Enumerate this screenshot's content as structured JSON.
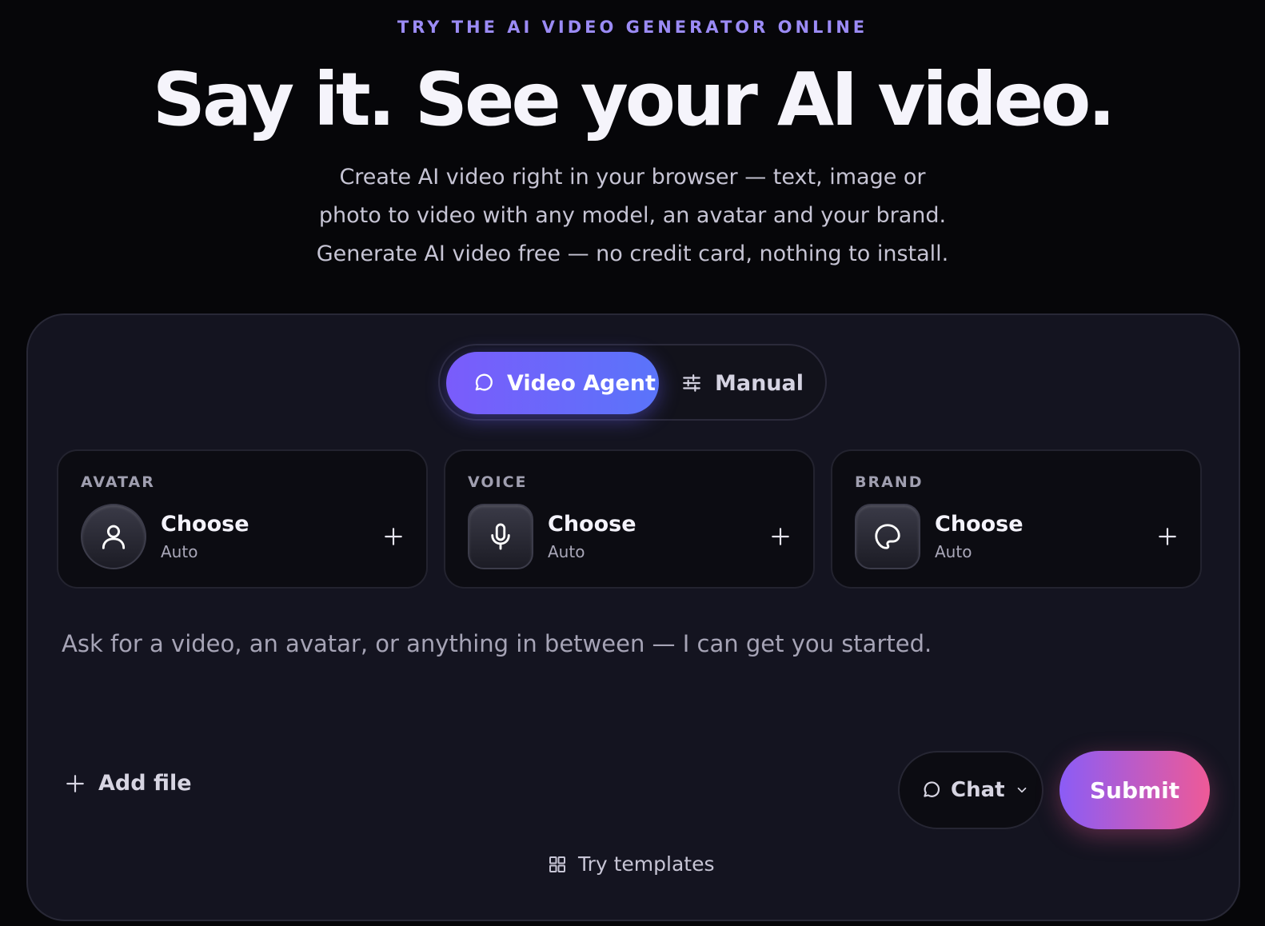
{
  "hero": {
    "eyebrow": "TRY THE AI VIDEO GENERATOR ONLINE",
    "headline": "Say it. See your AI video.",
    "subtitle": [
      "Create AI video right in your browser — text, image or",
      "photo to video with any model, an avatar and your brand.",
      "Generate AI video free — no credit card, nothing to install."
    ]
  },
  "modes": {
    "agent_label": "Video Agent",
    "manual_label": "Manual",
    "active": "Video Agent"
  },
  "slots": [
    {
      "label": "AVATAR",
      "title": "Choose",
      "value": "Auto",
      "icon": "user-icon"
    },
    {
      "label": "VOICE",
      "title": "Choose",
      "value": "Auto",
      "icon": "microphone-icon"
    },
    {
      "label": "BRAND",
      "title": "Choose",
      "value": "Auto",
      "icon": "palette-icon"
    }
  ],
  "prompt": {
    "placeholder": "Ask for a video, an avatar, or anything in between — I can get you started."
  },
  "actions": {
    "add_file": "Add file",
    "chat_mode": "Chat",
    "submit": "Submit",
    "templates": "Try templates"
  },
  "colors": {
    "accent_purple": "#7a5cfb",
    "accent_blue": "#5a74fa",
    "accent_pink": "#ee5a97",
    "eyebrow": "#9b8bf5"
  }
}
